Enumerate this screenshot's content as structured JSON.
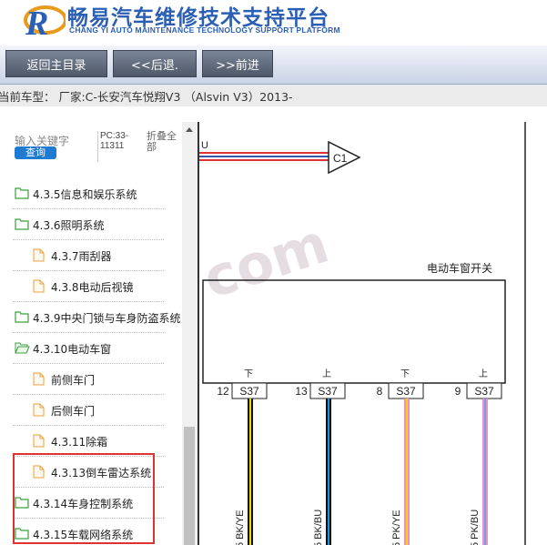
{
  "header": {
    "title_zh": "畅易汽车维修技术支持平台",
    "title_en": "CHANG YI AUTO MAINTENANCE TECHNOLOGY SUPPORT PLATFORM",
    "logo_letter": "R"
  },
  "nav": {
    "home": "返回主目录",
    "back": "<<后退.",
    "forward": ">>前进"
  },
  "car_info": "当前车型： 厂家:C-长安汽车悦翔V3 （Alsvin V3）2013-",
  "search": {
    "placeholder": "输入关键字",
    "query_button": "查询",
    "pc_code": "PC:33-11311",
    "collapse_all": "折叠全部"
  },
  "tree": [
    {
      "label": "4.3.5信息和娱乐系统",
      "type": "folder"
    },
    {
      "label": "4.3.6照明系统",
      "type": "folder"
    },
    {
      "label": "4.3.7雨刮器",
      "type": "file"
    },
    {
      "label": "4.3.8电动后视镜",
      "type": "file"
    },
    {
      "label": "4.3.9中央门锁与车身防盗系统",
      "type": "folder"
    },
    {
      "label": "4.3.10电动车窗",
      "type": "folder-open"
    },
    {
      "label": "前侧车门",
      "type": "file"
    },
    {
      "label": "后侧车门",
      "type": "file"
    },
    {
      "label": "4.3.11除霜",
      "type": "file"
    },
    {
      "label": "4.3.13倒车雷达系统",
      "type": "file"
    },
    {
      "label": "4.3.14车身控制系统",
      "type": "folder"
    },
    {
      "label": "4.3.15车载网络系统",
      "type": "folder"
    }
  ],
  "diagram": {
    "connector_c1": "C1",
    "wire_top_label": "U",
    "switch_title": "电动车窗开关",
    "watermark": "com",
    "pins": [
      {
        "num": "12",
        "conn": "S37",
        "dir": "下",
        "wire": "5 BK/YE",
        "color1": "#111111",
        "color2": "#f2d600"
      },
      {
        "num": "13",
        "conn": "S37",
        "dir": "上",
        "wire": "5 BK/BU",
        "color1": "#111111",
        "color2": "#1f8fe0"
      },
      {
        "num": "8",
        "conn": "S37",
        "dir": "下",
        "wire": "5 PK/YE",
        "color1": "#f08cc6",
        "color2": "#f2d600"
      },
      {
        "num": "9",
        "conn": "S37",
        "dir": "上",
        "wire": "5 PK/BU",
        "color1": "#f08cc6",
        "color2": "#6aa4e8"
      }
    ]
  },
  "colors": {
    "brand_blue": "#2b5fb4",
    "highlight_red": "#dd3333",
    "folder_green": "#3aa03a",
    "file_orange": "#e8a040"
  }
}
